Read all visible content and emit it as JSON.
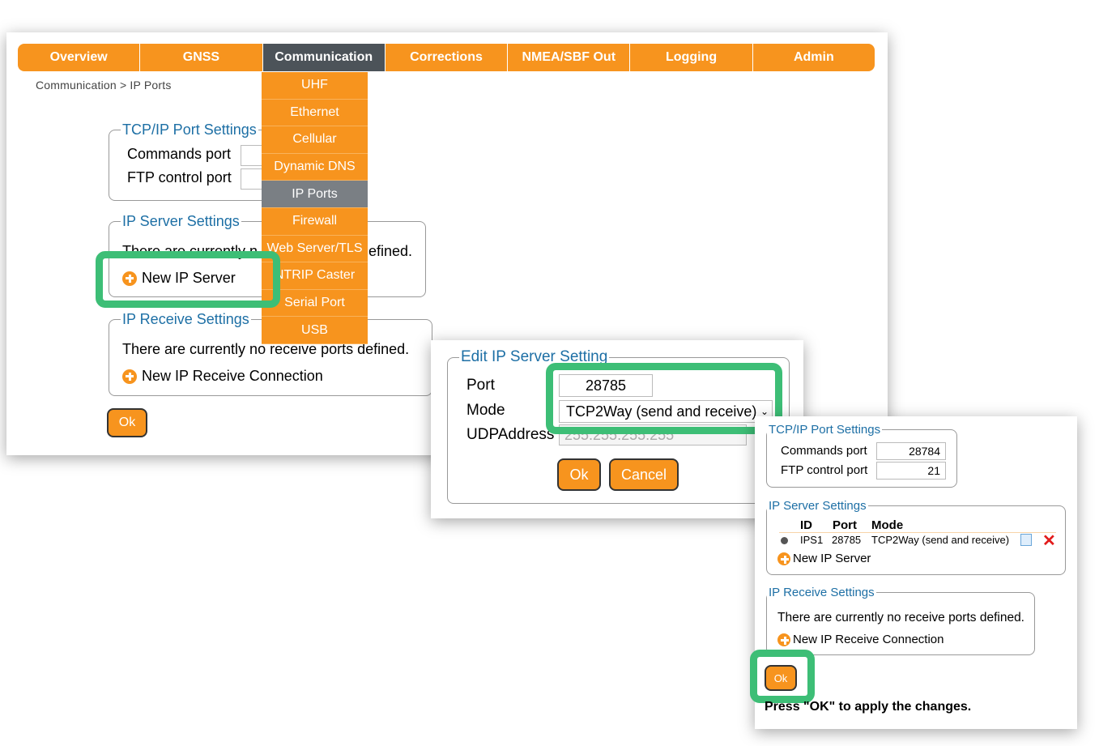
{
  "nav": {
    "tabs": [
      {
        "label": "Overview"
      },
      {
        "label": "GNSS"
      },
      {
        "label": "Communication"
      },
      {
        "label": "Corrections"
      },
      {
        "label": "NMEA/SBF Out"
      },
      {
        "label": "Logging"
      },
      {
        "label": "Admin"
      }
    ],
    "active": "Communication"
  },
  "breadcrumb": "Communication > IP Ports",
  "dropdown": {
    "items": [
      "UHF",
      "Ethernet",
      "Cellular",
      "Dynamic DNS",
      "IP Ports",
      "Firewall",
      "Web Server/TLS",
      "NTRIP Caster",
      "Serial Port",
      "USB"
    ],
    "active": "IP Ports"
  },
  "main": {
    "tcp": {
      "legend": "TCP/IP Port Settings",
      "commands_label": "Commands port",
      "ftp_label": "FTP control port"
    },
    "server": {
      "legend": "IP Server Settings",
      "text_a": "There are currently n",
      "text_b": "efined.",
      "new_label": "New IP Server"
    },
    "receive": {
      "legend": "IP Receive Settings",
      "text": "There are currently no receive ports defined.",
      "new_label": "New IP Receive Connection"
    },
    "ok_label": "Ok"
  },
  "edit": {
    "legend": "Edit IP Server Setting",
    "port_label": "Port",
    "port_value": "28785",
    "mode_label": "Mode",
    "mode_value": "TCP2Way (send and receive)",
    "udp_label": "UDPAddress",
    "udp_value": "255.255.255.255",
    "ok_label": "Ok",
    "cancel_label": "Cancel"
  },
  "result": {
    "tcp": {
      "legend": "TCP/IP Port Settings",
      "commands_label": "Commands port",
      "commands_value": "28784",
      "ftp_label": "FTP control port",
      "ftp_value": "21"
    },
    "server": {
      "legend": "IP Server Settings",
      "headers": {
        "id": "ID",
        "port": "Port",
        "mode": "Mode"
      },
      "row": {
        "id": "IPS1",
        "port": "28785",
        "mode": "TCP2Way (send and receive)"
      },
      "new_label": "New IP Server"
    },
    "receive": {
      "legend": "IP Receive Settings",
      "text": "There are currently no receive ports defined.",
      "new_label": "New IP Receive Connection"
    },
    "ok_label": "Ok",
    "apply_text": "Press \"OK\" to apply the changes."
  },
  "colors": {
    "accent": "#f7941e",
    "highlight": "#3dbe76",
    "legend": "#1d6fa5",
    "active_tab": "#4c5359"
  }
}
